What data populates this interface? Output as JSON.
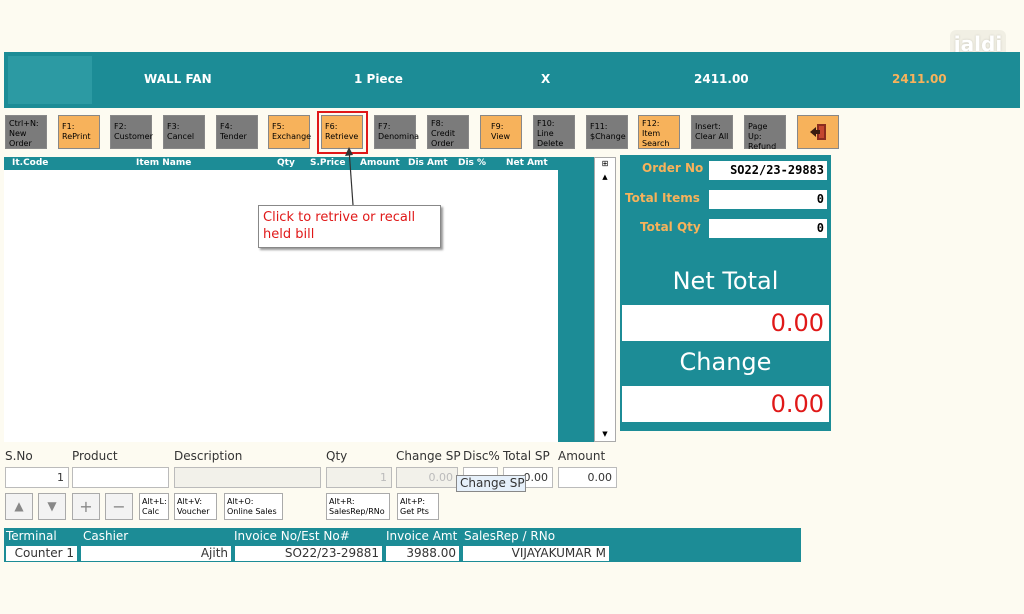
{
  "logo": "jaldi",
  "topbar": {
    "item_name": "WALL FAN",
    "qty": "1 Piece",
    "multiply": "X",
    "price": "2411.00",
    "total": "2411.00"
  },
  "fkeys": [
    {
      "line1": "Ctrl+N:",
      "line2": "New",
      "line3": "Order"
    },
    {
      "line1": "F1:",
      "line2": "RePrint",
      "line3": ""
    },
    {
      "line1": "F2:",
      "line2": "Customer",
      "line3": ""
    },
    {
      "line1": "F3:",
      "line2": "Cancel",
      "line3": ""
    },
    {
      "line1": "F4:",
      "line2": "Tender",
      "line3": ""
    },
    {
      "line1": "F5:",
      "line2": "Exchange",
      "line3": ""
    },
    {
      "line1": "F6:",
      "line2": "Retrieve",
      "line3": ""
    },
    {
      "line1": "F7:",
      "line2": "Denomina",
      "line3": ""
    },
    {
      "line1": "F8:",
      "line2": "Credit",
      "line3": "Order"
    },
    {
      "line1": "F9:",
      "line2": "View",
      "line3": ""
    },
    {
      "line1": "F10:",
      "line2": "Line",
      "line3": "Delete"
    },
    {
      "line1": "F11:",
      "line2": "$Change",
      "line3": ""
    },
    {
      "line1": "F12:",
      "line2": "Item",
      "line3": "Search"
    },
    {
      "line1": "Insert:",
      "line2": "Clear All",
      "line3": ""
    },
    {
      "line1": "Page Up:",
      "line2": "Refund",
      "line3": ""
    }
  ],
  "exit_icon": "exit-door-icon",
  "grid": {
    "columns": [
      "It.Code",
      "Item Name",
      "Qty",
      "S.Price",
      "Amount",
      "Dis Amt",
      "Dis %",
      "Net Amt"
    ],
    "rows": []
  },
  "callout": {
    "text_line1": "Click to retrive or recall",
    "text_line2": "held bill"
  },
  "panel": {
    "order_no_label": "Order No",
    "order_no": "SO22/23-29883",
    "total_items_label": "Total Items",
    "total_items": "0",
    "total_qty_label": "Total Qty",
    "total_qty": "0",
    "net_total_label": "Net Total",
    "net_total": "0.00",
    "change_label": "Change",
    "change": "0.00"
  },
  "entry": {
    "labels": {
      "sno": "S.No",
      "product": "Product",
      "description": "Description",
      "qty": "Qty",
      "change_sp": "Change SP",
      "disc": "Disc%",
      "total_sp": "Total SP",
      "amount": "Amount"
    },
    "values": {
      "sno": "1",
      "product": "",
      "description": "",
      "qty": "1",
      "change_sp": "0.00",
      "disc": "",
      "total_sp": "0.00",
      "amount": "0.00"
    },
    "tooltip": "Change SP"
  },
  "shortcuts": [
    {
      "line1": "Alt+L:",
      "line2": "Calc"
    },
    {
      "line1": "Alt+V:",
      "line2": "Voucher"
    },
    {
      "line1": "Alt+O:",
      "line2": "Online Sales"
    },
    {
      "line1": "Alt+R:",
      "line2": "SalesRep/RNo"
    },
    {
      "line1": "Alt+P:",
      "line2": "Get Pts"
    }
  ],
  "icon_buttons": {
    "up": "▲",
    "down": "▼",
    "plus": "+",
    "minus": "−"
  },
  "footer": {
    "terminal_label": "Terminal",
    "terminal": "Counter 1",
    "cashier_label": "Cashier",
    "cashier": "Ajith",
    "invoice_no_label": "Invoice No/Est No#",
    "invoice_no": "SO22/23-29881",
    "invoice_amt_label": "Invoice Amt",
    "invoice_amt": "3988.00",
    "salesrep_label": "SalesRep / RNo",
    "salesrep": "VIJAYAKUMAR M"
  },
  "colors": {
    "teal": "#1c8c96",
    "orange": "#f7b25b",
    "red": "#e01818",
    "grey": "#7b7b7b"
  }
}
